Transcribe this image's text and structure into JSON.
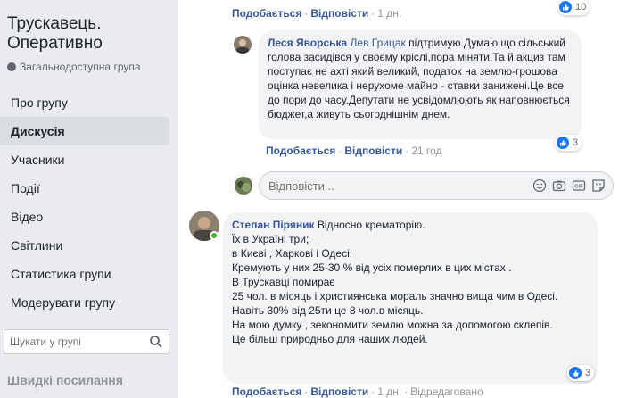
{
  "sidebar": {
    "group_title": "Трускавець. Оперативно",
    "group_type": "Загальнодоступна група",
    "nav": [
      "Про групу",
      "Дискусія",
      "Учасники",
      "Події",
      "Відео",
      "Світлини",
      "Статистика групи",
      "Модерувати групу"
    ],
    "active_nav": "Дискусія",
    "search_placeholder": "Шукати у групі",
    "quick_links": "Швидкі посилання"
  },
  "top_meta": {
    "like": "Подобається",
    "reply": "Відповісти",
    "time": "1 дн.",
    "reactions": "10"
  },
  "reply_comment": {
    "author": "Леся Яворська",
    "tag": "Лев Грицак",
    "text": " підтримую.Думаю що сільський голова засидівся у своєму кріслі,пора міняти.Та й акциз там поступає не ахті який великий, податок на землю-грошова оцінка невелика і нерухоме майно - ставки занижені.Це все до пори до часу.Депутати не усвідомлюють як наповнюється бюджет,а живуть сьогоднішнім днем.",
    "like": "Подобається",
    "reply": "Відповісти",
    "time": "21 год",
    "reactions": "3"
  },
  "reply_input_placeholder": "Відповісти...",
  "comment2": {
    "author": "Степан Піряник",
    "lines": [
      "Відносно крематорію.",
      "Їх в Україні три;",
      "в Києві , Харкові і Одесі.",
      "Кремують у них 25-30 % від усіх померлих в цих містах .",
      "В Трускавці помирає",
      "25 чол. в місяць і християнська мораль значно вища чим в Одесі.",
      "Навіть 30% від 25ти це 8 чол.в місяць.",
      "На мою думку , зекономити землю можна за допомогою склепів.",
      "Це більш природньо для наших людей."
    ],
    "like": "Подобається",
    "reply": "Відповісти",
    "time": "1 дн.",
    "edited": "Відредаговано",
    "reactions": "3"
  }
}
